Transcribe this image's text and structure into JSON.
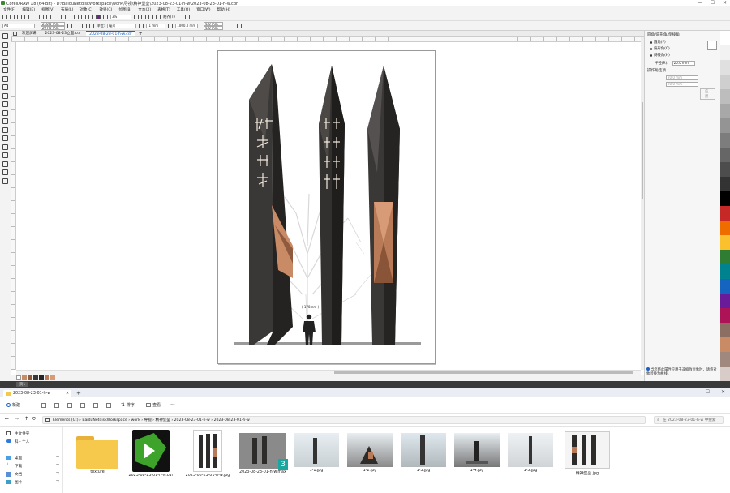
{
  "coreldraw": {
    "title": "CorelDRAW X8 (64-Bit) - D:\\BaiduNetdiskWorkspace\\work\\导视\\精神堡垒\\2023-08-23-01-h-w\\2023-08-23-01-h-w.cdr",
    "menu": [
      "文件(F)",
      "编辑(E)",
      "视图(V)",
      "布局(L)",
      "对象(C)",
      "效果(C)",
      "位图(B)",
      "文本(X)",
      "表格(T)",
      "工具(O)",
      "窗口(W)",
      "帮助(H)"
    ],
    "toolbar": {
      "zoom": "3%",
      "snap_label": "贴齐(T)"
    },
    "property_bar": {
      "page_size": "A4",
      "width": "210.0 mm",
      "height": "297.0 mm",
      "units_label": "单位:",
      "units": "毫米",
      "nudge": ".1 mm",
      "dup_distance": "1000.0 mm",
      "dup_x": "5.0 mm",
      "dup_y": "5.0 mm"
    },
    "tabs": [
      "欢迎屏幕",
      "2023-08-23立面.cdr",
      "2023-08-23-01-h-w.cdr"
    ],
    "right_panel": {
      "title": "圆角/扇形角/倒棱角",
      "options": [
        "圆角(F)",
        "扇形角(C)",
        "倒棱角(H)"
      ],
      "radius_label": "半径(R):",
      "radius_value": "20.0 mm",
      "section": "操作角选项",
      "dim1": "20.0 mm",
      "dim2": "20.0 mm",
      "apply": "应用",
      "hint": "当您将此属性应用于非缩放对象时，请将对象转换为曲线。"
    },
    "statusbar": {
      "text": "页1"
    },
    "drawing": {
      "dimension_label": "( 170mm )"
    }
  },
  "explorer": {
    "tab_title": "2023-08-23-01-h-w",
    "toolbar": {
      "new": "新建",
      "sort": "排序",
      "view": "查看"
    },
    "breadcrumb": [
      "Elements (G:)",
      "BaiduNetdiskWorkspace",
      "work",
      "导视",
      "精神堡垒",
      "2023-08-23-01-h-w",
      "2023-08-23-01-h-w"
    ],
    "search_placeholder": "在 2023-08-23-01-h-w 中搜索",
    "nav_items": [
      "主文件夹",
      "科 - 个人",
      "桌面",
      "下载",
      "文档",
      "图片"
    ],
    "files": [
      {
        "name": "texture",
        "kind": "folder"
      },
      {
        "name": "2023-08-23-01-h-w.cdr",
        "kind": "cdr"
      },
      {
        "name": "2023-08-23-01-h-w.jpg",
        "kind": "render"
      },
      {
        "name": "2023-08-23-01-h-w.max",
        "kind": "max"
      },
      {
        "name": "1-1.jpg",
        "kind": "photo"
      },
      {
        "name": "1-2.jpg",
        "kind": "photo"
      },
      {
        "name": "1-3.jpg",
        "kind": "photo"
      },
      {
        "name": "1-4.jpg",
        "kind": "photo"
      },
      {
        "name": "1-5.jpg",
        "kind": "photo"
      },
      {
        "name": "精神堡垒.jpg",
        "kind": "photo"
      }
    ]
  }
}
